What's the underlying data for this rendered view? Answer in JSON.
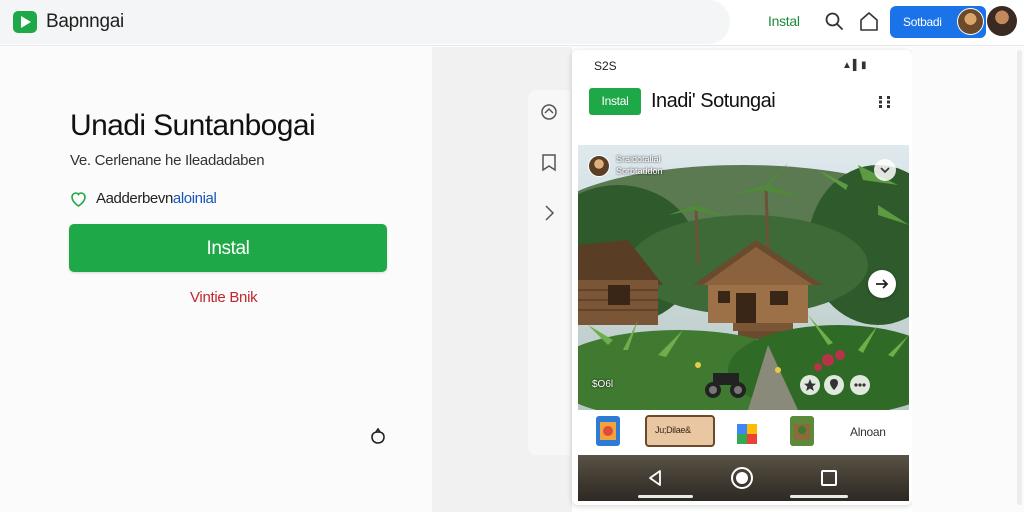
{
  "header": {
    "brand_name": "Bapnngai",
    "install_link": "Instal",
    "signin_label": "Sotbadi",
    "icons": [
      "play-logo-icon",
      "search-icon",
      "home-icon"
    ]
  },
  "app_listing": {
    "title": "Unadi Suntanbogai",
    "subtitle": "Ve. Cerlenane he Ileadadaben",
    "developer_prefix": "Aadderbevn",
    "developer_accent": "aloinial",
    "install_label": "Instal",
    "secondary_link": "Vintie Bnik",
    "verified_icon": "shield-check-icon",
    "bottom_icon": "share-icon"
  },
  "side_rail": {
    "icons": [
      "home-outline-icon",
      "bookmark-icon",
      "chevron-right-icon"
    ]
  },
  "phone": {
    "status_time": "S2S",
    "status_icons": "▲▌▮",
    "install_label": "Instal",
    "title": "Inadi' Sotungai",
    "hero": {
      "caption_line1": "Sraidotalial",
      "caption_line2": "Sorbtaddon",
      "price_text": "$O6l"
    },
    "app_row": {
      "chip_text": "Ju;Dilae&",
      "label": "Alnoan"
    },
    "nav": [
      "back-icon",
      "home-icon",
      "recents-icon"
    ]
  },
  "colors": {
    "install_green": "#1fa848",
    "signin_blue": "#1a73e8",
    "link_red": "#c0262d",
    "accent_blue": "#1a56b8"
  }
}
